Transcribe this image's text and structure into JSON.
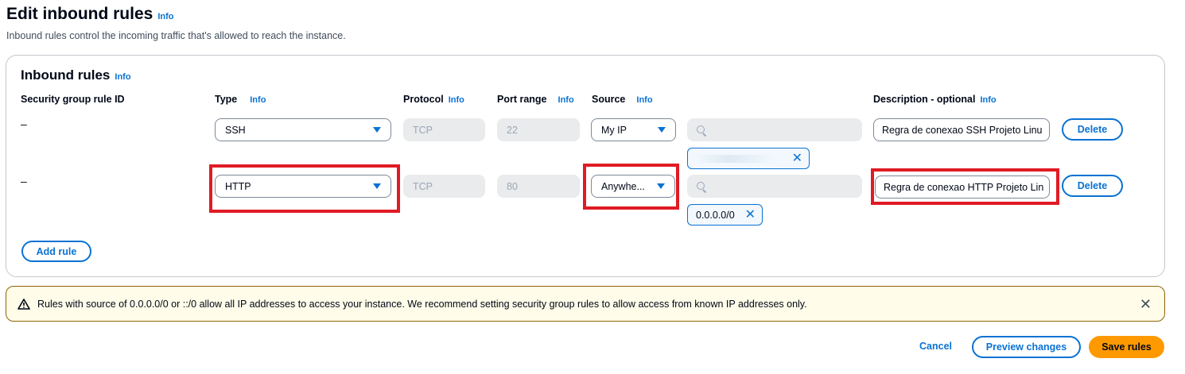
{
  "header": {
    "title": "Edit inbound rules",
    "info": "Info",
    "subtitle": "Inbound rules control the incoming traffic that's allowed to reach the instance."
  },
  "panel": {
    "title": "Inbound rules",
    "info": "Info",
    "columns": {
      "rule_id": "Security group rule ID",
      "type": "Type",
      "protocol": "Protocol",
      "port_range": "Port range",
      "source": "Source",
      "description": "Description - optional",
      "info": "Info"
    },
    "rows": [
      {
        "rule_id": "–",
        "type": "SSH",
        "protocol": "TCP",
        "port_range": "22",
        "source": "My IP",
        "cidr_token": "",
        "description": "Regra de conexao SSH Projeto Linu",
        "delete": "Delete"
      },
      {
        "rule_id": "–",
        "type": "HTTP",
        "protocol": "TCP",
        "port_range": "80",
        "source": "Anywhe...",
        "cidr_token": "0.0.0.0/0",
        "description": "Regra de conexao HTTP Projeto Lin",
        "delete": "Delete"
      }
    ],
    "add_rule": "Add rule"
  },
  "warning": {
    "text": "Rules with source of 0.0.0.0/0 or ::/0 allow all IP addresses to access your instance. We recommend setting security group rules to allow access from known IP addresses only."
  },
  "footer": {
    "cancel": "Cancel",
    "preview": "Preview changes",
    "save": "Save rules"
  },
  "colors": {
    "accent": "#0972d3",
    "primary_button": "#ff9900",
    "highlight": "#e01b24",
    "warning_bg": "#fffce9"
  }
}
